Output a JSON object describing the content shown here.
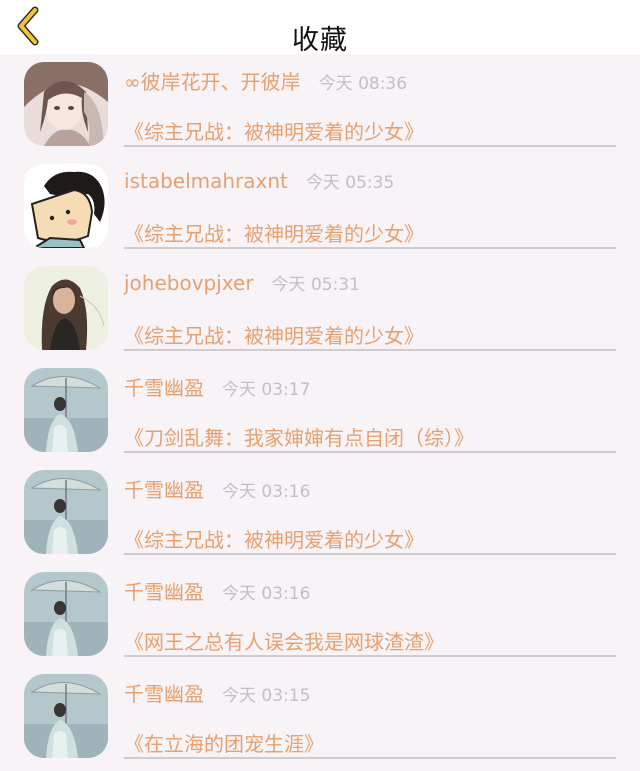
{
  "nav": {
    "title": "收藏",
    "back_icon": "chevron-left-icon",
    "accent": "#f2c23b"
  },
  "colors": {
    "username": "#e8a06f",
    "time": "#c3bfc3",
    "background": "#f7f3f7"
  },
  "favorites": [
    {
      "user": "∞彼岸花开、开彼岸",
      "time": "今天 08:36",
      "book": "《综主兄战：被神明爱着的少女》",
      "avatar": "anime-girl-avatar"
    },
    {
      "user": "istabelmahraxnt",
      "time": "今天 05:35",
      "book": "《综主兄战：被神明爱着的少女》",
      "avatar": "cartoon-face-avatar"
    },
    {
      "user": "johebovpjxer",
      "time": "今天 05:31",
      "book": "《综主兄战：被神明爱着的少女》",
      "avatar": "woman-portrait-avatar"
    },
    {
      "user": "千雪幽盈",
      "time": "今天 03:17",
      "book": "《刀剑乱舞：我家婶婶有点自闭（综）》",
      "avatar": "umbrella-girl-avatar"
    },
    {
      "user": "千雪幽盈",
      "time": "今天 03:16",
      "book": "《综主兄战：被神明爱着的少女》",
      "avatar": "umbrella-girl-avatar"
    },
    {
      "user": "千雪幽盈",
      "time": "今天 03:16",
      "book": "《网王之总有人误会我是网球渣渣》",
      "avatar": "umbrella-girl-avatar"
    },
    {
      "user": "千雪幽盈",
      "time": "今天 03:15",
      "book": "《在立海的团宠生涯》",
      "avatar": "umbrella-girl-avatar"
    }
  ]
}
